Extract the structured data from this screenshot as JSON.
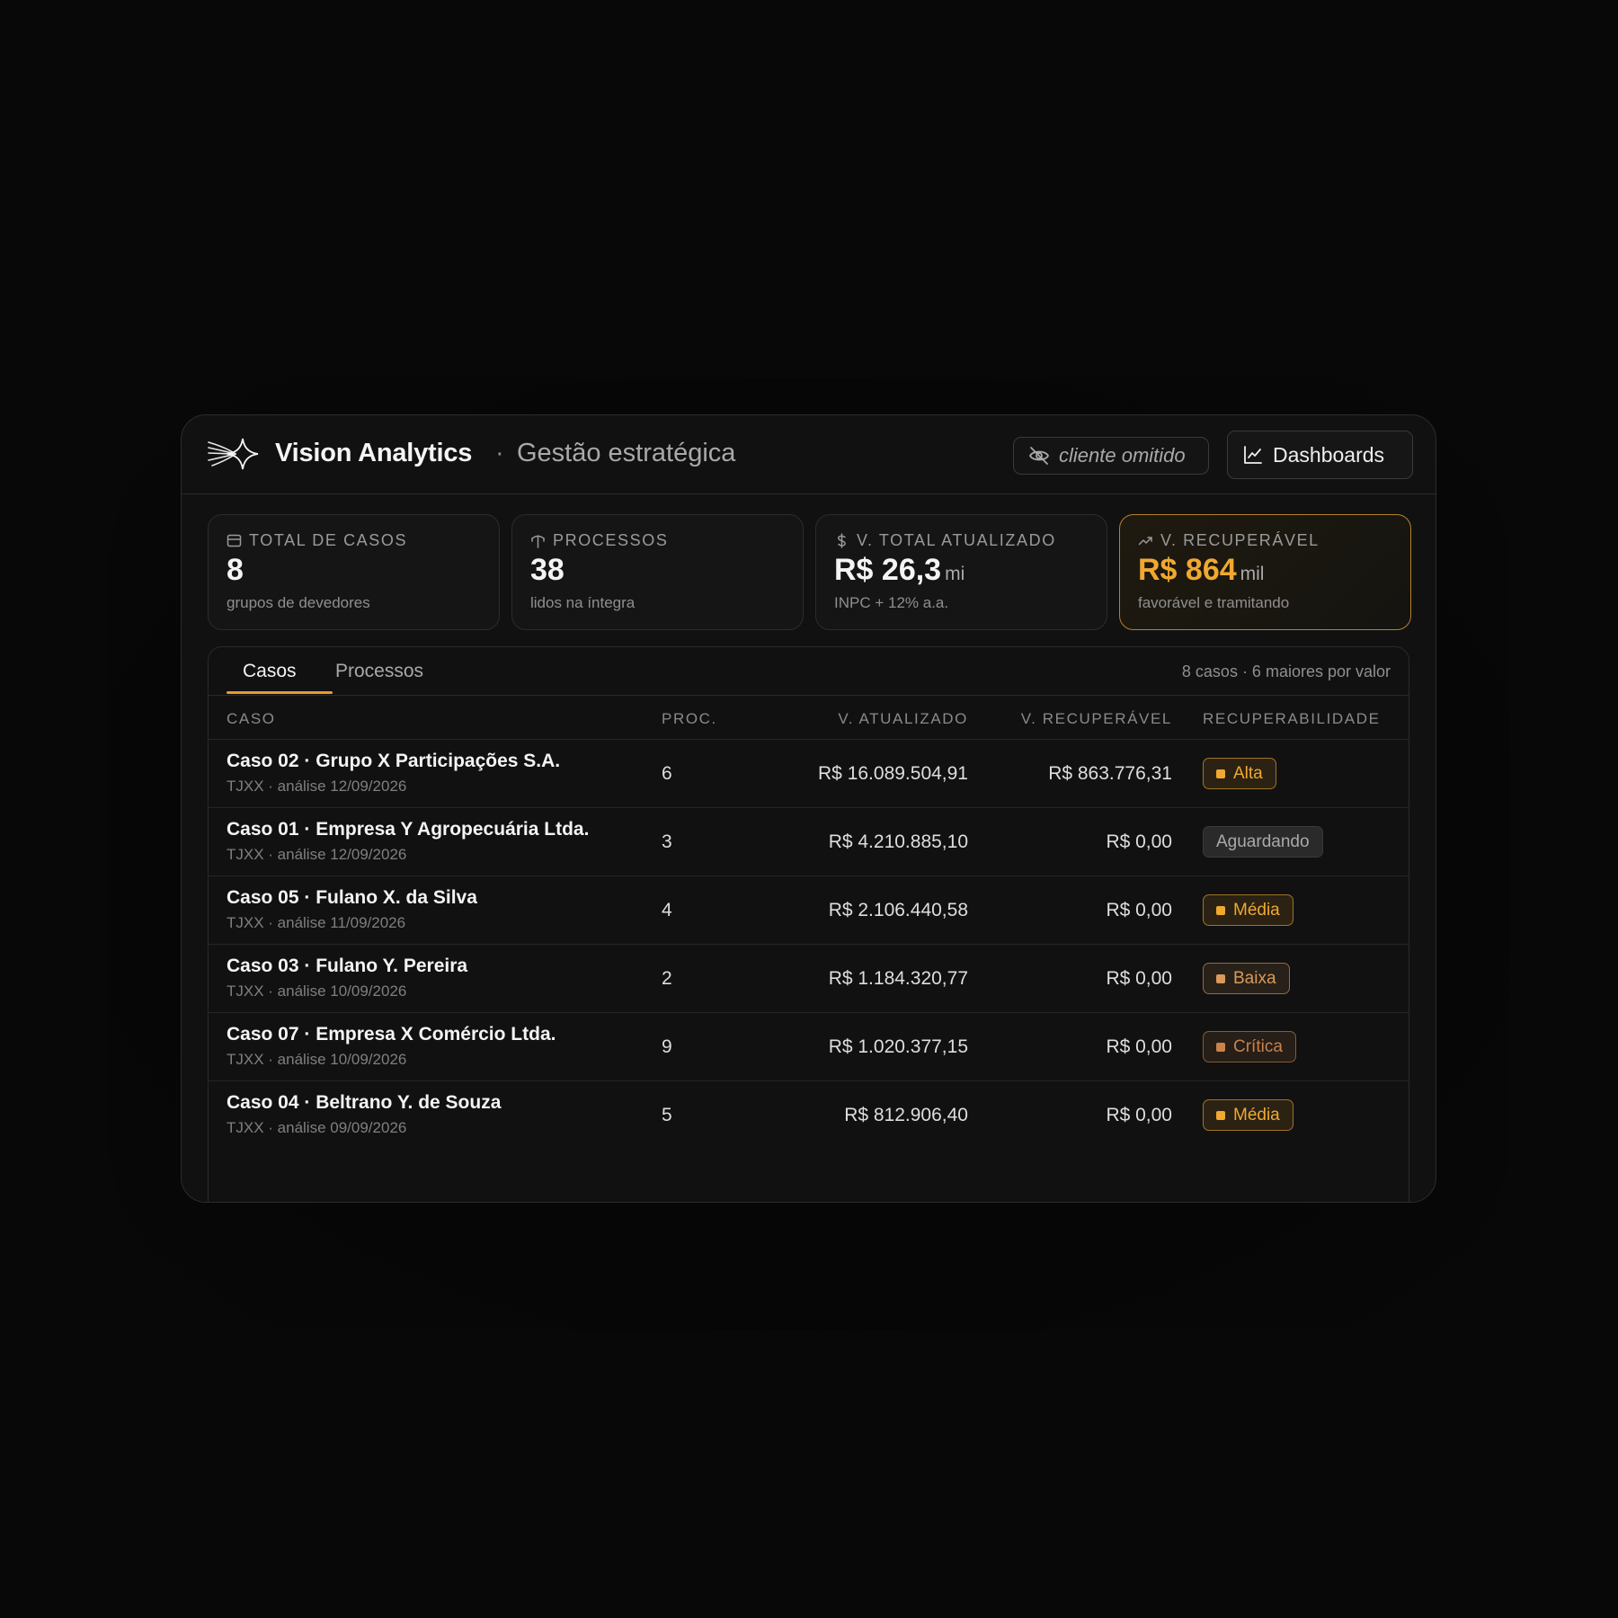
{
  "header": {
    "brand": "Vision Analytics",
    "separator": "·",
    "subtitle": "Gestão estratégica",
    "client_pill": "cliente omitido",
    "dashboards_button": "Dashboards"
  },
  "cards": [
    {
      "label": "TOTAL DE CASOS",
      "icon": "calendar-icon",
      "value": "8",
      "unit": "",
      "sub": "grupos de devedores"
    },
    {
      "label": "PROCESSOS",
      "icon": "gavel-icon",
      "value": "38",
      "unit": "",
      "sub": "lidos na íntegra"
    },
    {
      "label": "V. TOTAL ATUALIZADO",
      "icon": "dollar-icon",
      "value": "R$ 26,3",
      "unit": "mi",
      "sub": "INPC + 12% a.a."
    },
    {
      "label": "V. RECUPERÁVEL",
      "icon": "trending-up-icon",
      "value": "R$ 864",
      "unit": "mil",
      "sub": "favorável e tramitando"
    }
  ],
  "tabs": {
    "active": "Casos",
    "inactive": "Processos",
    "meta": "8 casos · 6 maiores por valor"
  },
  "table": {
    "headers": {
      "caso": "CASO",
      "proc": "PROC.",
      "atualizado": "V. ATUALIZADO",
      "recuperavel": "V. RECUPERÁVEL",
      "recuperabilidade": "RECUPERABILIDADE"
    },
    "rows": [
      {
        "name": "Caso 02 · Grupo X Participações S.A.",
        "sub": "TJXX · análise 12/09/2026",
        "proc": "6",
        "atualizado": "R$ 16.089.504,91",
        "recuperavel": "R$ 863.776,31",
        "status": "Alta",
        "status_color": "#f0a830",
        "dot": true
      },
      {
        "name": "Caso 01 · Empresa Y Agropecuária Ltda.",
        "sub": "TJXX · análise 12/09/2026",
        "proc": "3",
        "atualizado": "R$ 4.210.885,10",
        "recuperavel": "R$ 0,00",
        "status": "Aguardando",
        "status_color": "#a9a9a9",
        "dot": false
      },
      {
        "name": "Caso 05 · Fulano X. da Silva",
        "sub": "TJXX · análise 11/09/2026",
        "proc": "4",
        "atualizado": "R$ 2.106.440,58",
        "recuperavel": "R$ 0,00",
        "status": "Média",
        "status_color": "#f0a830",
        "dot": true
      },
      {
        "name": "Caso 03 · Fulano Y. Pereira",
        "sub": "TJXX · análise 10/09/2026",
        "proc": "2",
        "atualizado": "R$ 1.184.320,77",
        "recuperavel": "R$ 0,00",
        "status": "Baixa",
        "status_color": "#d99a5a",
        "dot": true
      },
      {
        "name": "Caso 07 · Empresa X Comércio Ltda.",
        "sub": "TJXX · análise 10/09/2026",
        "proc": "9",
        "atualizado": "R$ 1.020.377,15",
        "recuperavel": "R$ 0,00",
        "status": "Crítica",
        "status_color": "#c8824a",
        "dot": true
      },
      {
        "name": "Caso 04 · Beltrano Y. de Souza",
        "sub": "TJXX · análise 09/09/2026",
        "proc": "5",
        "atualizado": "R$ 812.906,40",
        "recuperavel": "R$ 0,00",
        "status": "Média",
        "status_color": "#f0a830",
        "dot": true
      }
    ]
  }
}
